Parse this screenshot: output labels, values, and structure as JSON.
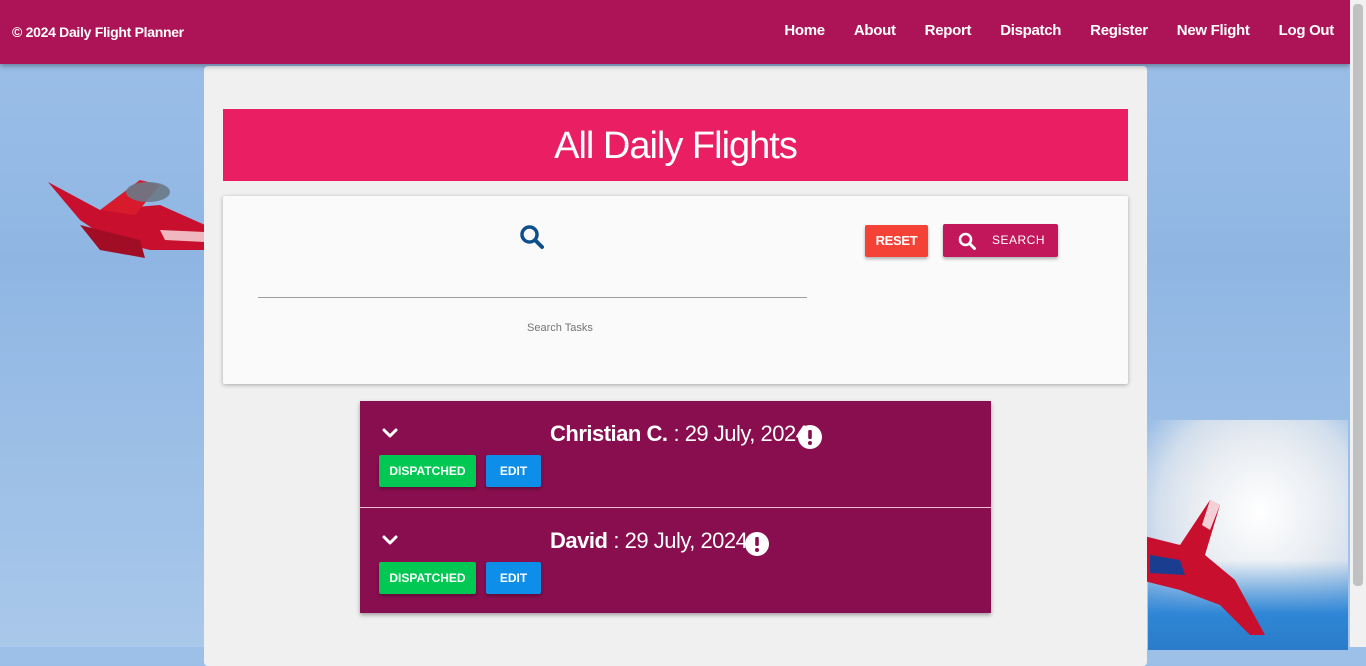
{
  "header": {
    "brand": "© 2024 Daily Flight Planner",
    "nav": [
      "Home",
      "About",
      "Report",
      "Dispatch",
      "Register",
      "New Flight",
      "Log Out"
    ]
  },
  "page": {
    "title": "All Daily Flights"
  },
  "search": {
    "label": "Search Tasks",
    "value": "",
    "reset_label": "RESET",
    "search_label": "SEARCH"
  },
  "flights": [
    {
      "name": "Christian C.",
      "date": ": 29 July, 2024",
      "status_label": "DISPATCHED",
      "edit_label": "EDIT"
    },
    {
      "name": "David",
      "date": ": 29 July, 2024",
      "status_label": "DISPATCHED",
      "edit_label": "EDIT"
    }
  ],
  "colors": {
    "topbar": "#ad1457",
    "title_bar": "#e91e63",
    "flight_card": "#880e4f",
    "reset": "#f44336",
    "search": "#c2185b",
    "dispatched": "#00c853",
    "edit": "#0d8ee9"
  },
  "icons": [
    "search-icon",
    "chevron-down-icon",
    "alert-circle-icon"
  ]
}
